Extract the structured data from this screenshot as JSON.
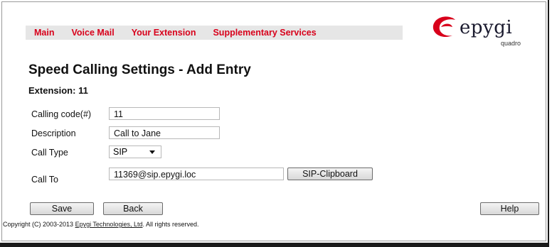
{
  "nav": {
    "items": [
      "Main",
      "Voice Mail",
      "Your Extension",
      "Supplementary Services"
    ]
  },
  "logo": {
    "text": "epygi",
    "sub": "quadro"
  },
  "page": {
    "title": "Speed Calling Settings - Add Entry",
    "extension": "Extension: 11"
  },
  "form": {
    "calling_code_label": "Calling code(#)",
    "calling_code_value": "11",
    "description_label": "Description",
    "description_value": "Call to Jane",
    "call_type_label": "Call Type",
    "call_type_value": "SIP",
    "call_to_label": "Call To",
    "call_to_value": "11369@sip.epygi.loc",
    "clipboard_button": "SIP-Clipboard"
  },
  "buttons": {
    "save": "Save",
    "back": "Back",
    "help": "Help"
  },
  "footer": {
    "prefix": "Copyright (C) 2003-2013 ",
    "company": "Epygi Technologies, Ltd",
    "suffix": ". All rights reserved."
  },
  "colors": {
    "nav_text": "#d8001b",
    "logo_red": "#d8001b"
  }
}
